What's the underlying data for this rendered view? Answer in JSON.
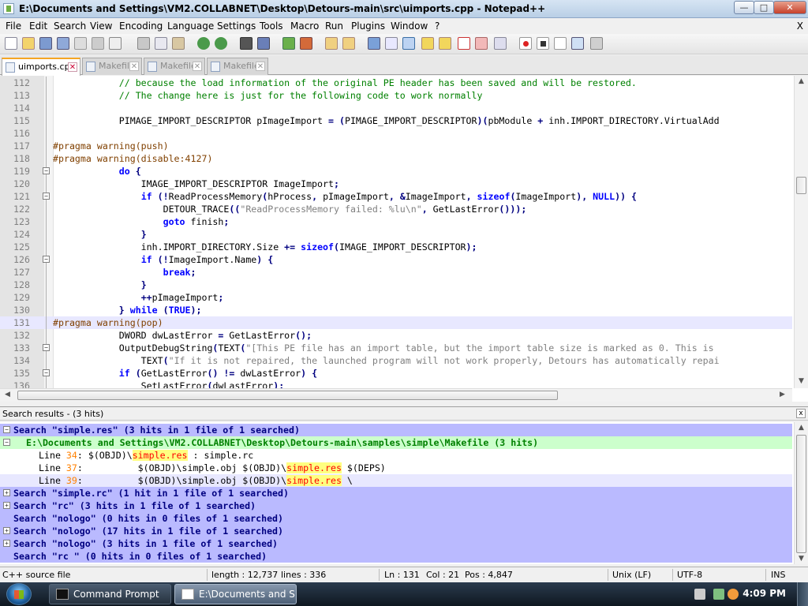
{
  "window": {
    "title": "E:\\Documents and Settings\\VM2.COLLABNET\\Desktop\\Detours-main\\src\\uimports.cpp - Notepad++",
    "min_label": "—",
    "max_label": "□",
    "close_label": "✕"
  },
  "menu": {
    "items": [
      "File",
      "Edit",
      "Search",
      "View",
      "Encoding",
      "Language",
      "Settings",
      "Tools",
      "Macro",
      "Run",
      "Plugins",
      "Window",
      "?"
    ],
    "close_label": "X"
  },
  "tabs": [
    {
      "label": "uimports.cpp",
      "active": true
    },
    {
      "label": "Makefile",
      "active": false
    },
    {
      "label": "Makefile",
      "active": false
    },
    {
      "label": "Makefile",
      "active": false
    }
  ],
  "editor": {
    "lines": [
      {
        "n": "112",
        "fold": "",
        "text": "            // because the load information of the original PE header has been saved and will be restored."
      },
      {
        "n": "113",
        "fold": "",
        "text": "            // The change here is just for the following code to work normally"
      },
      {
        "n": "114",
        "fold": "",
        "text": ""
      },
      {
        "n": "115",
        "fold": "",
        "text": "            PIMAGE_IMPORT_DESCRIPTOR pImageImport = (PIMAGE_IMPORT_DESCRIPTOR)(pbModule + inh.IMPORT_DIRECTORY.VirtualAdd"
      },
      {
        "n": "116",
        "fold": "",
        "text": ""
      },
      {
        "n": "117",
        "fold": "",
        "text": "#pragma warning(push)"
      },
      {
        "n": "118",
        "fold": "",
        "text": "#pragma warning(disable:4127)"
      },
      {
        "n": "119",
        "fold": "minus",
        "text": "            do {"
      },
      {
        "n": "120",
        "fold": "",
        "text": "                IMAGE_IMPORT_DESCRIPTOR ImageImport;"
      },
      {
        "n": "121",
        "fold": "minus",
        "text": "                if (!ReadProcessMemory(hProcess, pImageImport, &ImageImport, sizeof(ImageImport), NULL)) {"
      },
      {
        "n": "122",
        "fold": "",
        "text": "                    DETOUR_TRACE((\"ReadProcessMemory failed: %lu\\n\", GetLastError()));"
      },
      {
        "n": "123",
        "fold": "",
        "text": "                    goto finish;"
      },
      {
        "n": "124",
        "fold": "",
        "text": "                }"
      },
      {
        "n": "125",
        "fold": "",
        "text": "                inh.IMPORT_DIRECTORY.Size += sizeof(IMAGE_IMPORT_DESCRIPTOR);"
      },
      {
        "n": "126",
        "fold": "minus",
        "text": "                if (!ImageImport.Name) {"
      },
      {
        "n": "127",
        "fold": "",
        "text": "                    break;"
      },
      {
        "n": "128",
        "fold": "",
        "text": "                }"
      },
      {
        "n": "129",
        "fold": "",
        "text": "                ++pImageImport;"
      },
      {
        "n": "130",
        "fold": "",
        "text": "            } while (TRUE);"
      },
      {
        "n": "131",
        "fold": "",
        "text": "#pragma warning(pop)"
      },
      {
        "n": "132",
        "fold": "",
        "text": "            DWORD dwLastError = GetLastError();"
      },
      {
        "n": "133",
        "fold": "minus",
        "text": "            OutputDebugString(TEXT(\"[This PE file has an import table, but the import table size is marked as 0. This is"
      },
      {
        "n": "134",
        "fold": "",
        "text": "                TEXT(\"If it is not repaired, the launched program will not work properly, Detours has automatically repai"
      },
      {
        "n": "135",
        "fold": "minus",
        "text": "            if (GetLastError() != dwLastError) {"
      },
      {
        "n": "136",
        "fold": "",
        "text": "                SetLastError(dwLastError);"
      }
    ],
    "current_line": "131"
  },
  "search_panel": {
    "title": "Search results - (3 hits)",
    "close_label": "x",
    "results": [
      {
        "kind": "search",
        "fold": "minus",
        "text": "Search \"simple.res\" (3 hits in 1 file of 1 searched)"
      },
      {
        "kind": "file",
        "fold": "minus",
        "text": "E:\\Documents and Settings\\VM2.COLLABNET\\Desktop\\Detours-main\\samples\\simple\\Makefile (3 hits)"
      },
      {
        "kind": "hit",
        "prefix": "Line ",
        "lineno": "34",
        "before": ": $(OBJD)\\",
        "match": "simple.res",
        "after": " : simple.rc",
        "selected": false
      },
      {
        "kind": "hit",
        "prefix": "Line ",
        "lineno": "37",
        "before": ":          $(OBJD)\\simple.obj $(OBJD)\\",
        "match": "simple.res",
        "after": " $(DEPS)",
        "selected": false
      },
      {
        "kind": "hit",
        "prefix": "Line ",
        "lineno": "39",
        "before": ":          $(OBJD)\\simple.obj $(OBJD)\\",
        "match": "simple.res",
        "after": " \\",
        "selected": true
      },
      {
        "kind": "search",
        "fold": "plus",
        "text": "Search \"simple.rc\" (1 hit in 1 file of 1 searched)"
      },
      {
        "kind": "search",
        "fold": "plus",
        "text": "Search \"rc\" (3 hits in 1 file of 1 searched)"
      },
      {
        "kind": "search",
        "fold": "",
        "text": "Search \"nologo\" (0 hits in 0 files of 1 searched)"
      },
      {
        "kind": "search",
        "fold": "plus",
        "text": "Search \"nologo\" (17 hits in 1 file of 1 searched)"
      },
      {
        "kind": "search",
        "fold": "plus",
        "text": "Search \"nologo\" (3 hits in 1 file of 1 searched)"
      },
      {
        "kind": "search",
        "fold": "",
        "text": "Search \"rc \" (0 hits in 0 files of 1 searched)"
      }
    ]
  },
  "status": {
    "filetype": "C++ source file",
    "length": "length : 12,737",
    "lines": "lines : 336",
    "ln": "Ln : 131",
    "col": "Col : 21",
    "pos": "Pos : 4,847",
    "eol": "Unix (LF)",
    "encoding": "UTF-8",
    "mode": "INS"
  },
  "taskbar": {
    "tasks": [
      {
        "label": "Command Prompt",
        "active": false
      },
      {
        "label": "E:\\Documents and S...",
        "active": true
      }
    ],
    "clock": "4:09 PM"
  },
  "colors": {
    "comment": "#008000",
    "preprocessor": "#804000",
    "keyword": "#0000ff",
    "string": "#808080",
    "search_header_bg": "#babaff",
    "file_header_bg": "#ccffcc",
    "match_highlight": "#ffff80"
  }
}
